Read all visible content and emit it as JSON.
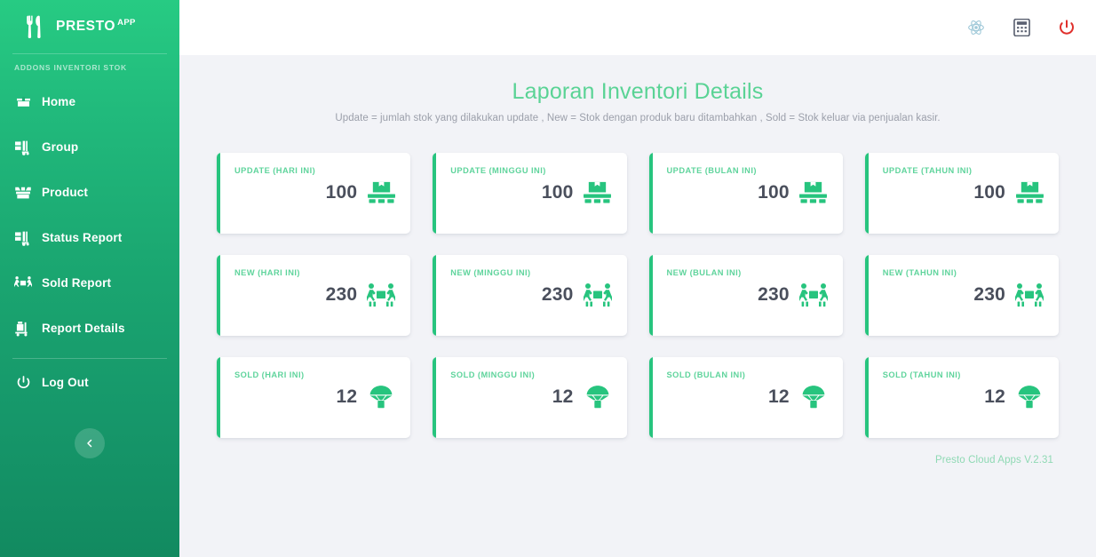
{
  "sidebar": {
    "brand": {
      "name": "PRESTO",
      "sup": "APP",
      "logo_icon": "fork-knife-icon"
    },
    "section_label": "ADDONS INVENTORI STOK",
    "items": [
      {
        "label": "Home",
        "icon": "box-home-icon"
      },
      {
        "label": "Group",
        "icon": "forklift-icon"
      },
      {
        "label": "Product",
        "icon": "open-box-icon"
      },
      {
        "label": "Status Report",
        "icon": "forklift-icon"
      },
      {
        "label": "Sold Report",
        "icon": "people-carry-icon"
      },
      {
        "label": "Report Details",
        "icon": "cart-flatbed-icon"
      }
    ],
    "logout": {
      "label": "Log Out",
      "icon": "power-icon"
    },
    "collapse": {
      "icon": "chevron-left-icon"
    }
  },
  "topbar": {
    "icons": [
      {
        "name": "atom-icon",
        "color": "#9ec8d8"
      },
      {
        "name": "calculator-icon",
        "color": "#5a6070"
      },
      {
        "name": "power-icon",
        "color": "#e0302c"
      }
    ]
  },
  "main": {
    "title": "Laporan Inventori Details",
    "subtitle": "Update = jumlah stok yang dilakukan update , New = Stok dengan produk baru ditambahkan , Sold = Stok keluar via penjualan kasir.",
    "footer_version": "Presto Cloud Apps V.2.31",
    "cards": [
      {
        "label": "UPDATE (HARI INI)",
        "value": "100",
        "icon": "pallet-box-icon"
      },
      {
        "label": "UPDATE (MINGGU INI)",
        "value": "100",
        "icon": "pallet-box-icon"
      },
      {
        "label": "UPDATE (BULAN INI)",
        "value": "100",
        "icon": "pallet-box-icon"
      },
      {
        "label": "UPDATE (TAHUN INI)",
        "value": "100",
        "icon": "pallet-box-icon"
      },
      {
        "label": "NEW (HARI INI)",
        "value": "230",
        "icon": "people-carry-box-icon"
      },
      {
        "label": "NEW (MINGGU INI)",
        "value": "230",
        "icon": "people-carry-box-icon"
      },
      {
        "label": "NEW (BULAN INI)",
        "value": "230",
        "icon": "people-carry-box-icon"
      },
      {
        "label": "NEW (TAHUN INI)",
        "value": "230",
        "icon": "people-carry-box-icon"
      },
      {
        "label": "SOLD (HARI INI)",
        "value": "12",
        "icon": "parachute-box-icon"
      },
      {
        "label": "SOLD (MINGGU INI)",
        "value": "12",
        "icon": "parachute-box-icon"
      },
      {
        "label": "SOLD (BULAN INI)",
        "value": "12",
        "icon": "parachute-box-icon"
      },
      {
        "label": "SOLD (TAHUN INI)",
        "value": "12",
        "icon": "parachute-box-icon"
      }
    ]
  },
  "colors": {
    "brand_green": "#27c47e",
    "sidebar_top": "#27cb83",
    "sidebar_bottom": "#128a60",
    "title_green": "#5ad395",
    "page_bg": "#f2f3f7",
    "card_value": "#4a4f5c"
  }
}
